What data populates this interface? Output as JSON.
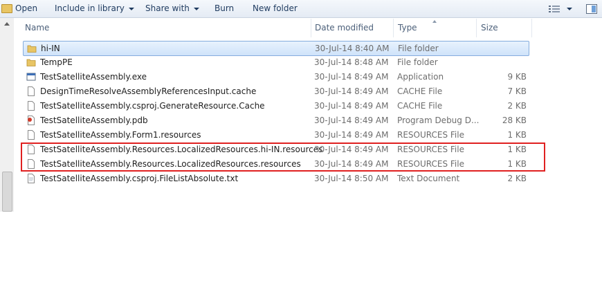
{
  "toolbar": {
    "open": "Open",
    "include_in_library": "Include in library",
    "share_with": "Share with",
    "burn": "Burn",
    "new_folder": "New folder"
  },
  "columns": {
    "name": "Name",
    "date_modified": "Date modified",
    "type": "Type",
    "size": "Size"
  },
  "files": [
    {
      "name": "hi-IN",
      "date": "30-Jul-14 8:40 AM",
      "type": "File folder",
      "size": "",
      "icon": "folder-icon",
      "selected": true
    },
    {
      "name": "TempPE",
      "date": "30-Jul-14 8:48 AM",
      "type": "File folder",
      "size": "",
      "icon": "folder-icon"
    },
    {
      "name": "TestSatelliteAssembly.exe",
      "date": "30-Jul-14 8:49 AM",
      "type": "Application",
      "size": "9 KB",
      "icon": "application-icon"
    },
    {
      "name": "DesignTimeResolveAssemblyReferencesInput.cache",
      "date": "30-Jul-14 8:49 AM",
      "type": "CACHE File",
      "size": "7 KB",
      "icon": "file-icon"
    },
    {
      "name": "TestSatelliteAssembly.csproj.GenerateResource.Cache",
      "date": "30-Jul-14 8:49 AM",
      "type": "CACHE File",
      "size": "2 KB",
      "icon": "file-icon"
    },
    {
      "name": "TestSatelliteAssembly.pdb",
      "date": "30-Jul-14 8:49 AM",
      "type": "Program Debug D...",
      "size": "28 KB",
      "icon": "pdb-icon"
    },
    {
      "name": "TestSatelliteAssembly.Form1.resources",
      "date": "30-Jul-14 8:49 AM",
      "type": "RESOURCES File",
      "size": "1 KB",
      "icon": "file-icon"
    },
    {
      "name": "TestSatelliteAssembly.Resources.LocalizedResources.hi-IN.resources",
      "date": "30-Jul-14 8:49 AM",
      "type": "RESOURCES File",
      "size": "1 KB",
      "icon": "file-icon"
    },
    {
      "name": "TestSatelliteAssembly.Resources.LocalizedResources.resources",
      "date": "30-Jul-14 8:49 AM",
      "type": "RESOURCES File",
      "size": "1 KB",
      "icon": "file-icon"
    },
    {
      "name": "TestSatelliteAssembly.csproj.FileListAbsolute.txt",
      "date": "30-Jul-14 8:50 AM",
      "type": "Text Document",
      "size": "2 KB",
      "icon": "text-file-icon"
    }
  ],
  "highlight_color": "#e02020",
  "selection_color": "#cfe3fa"
}
